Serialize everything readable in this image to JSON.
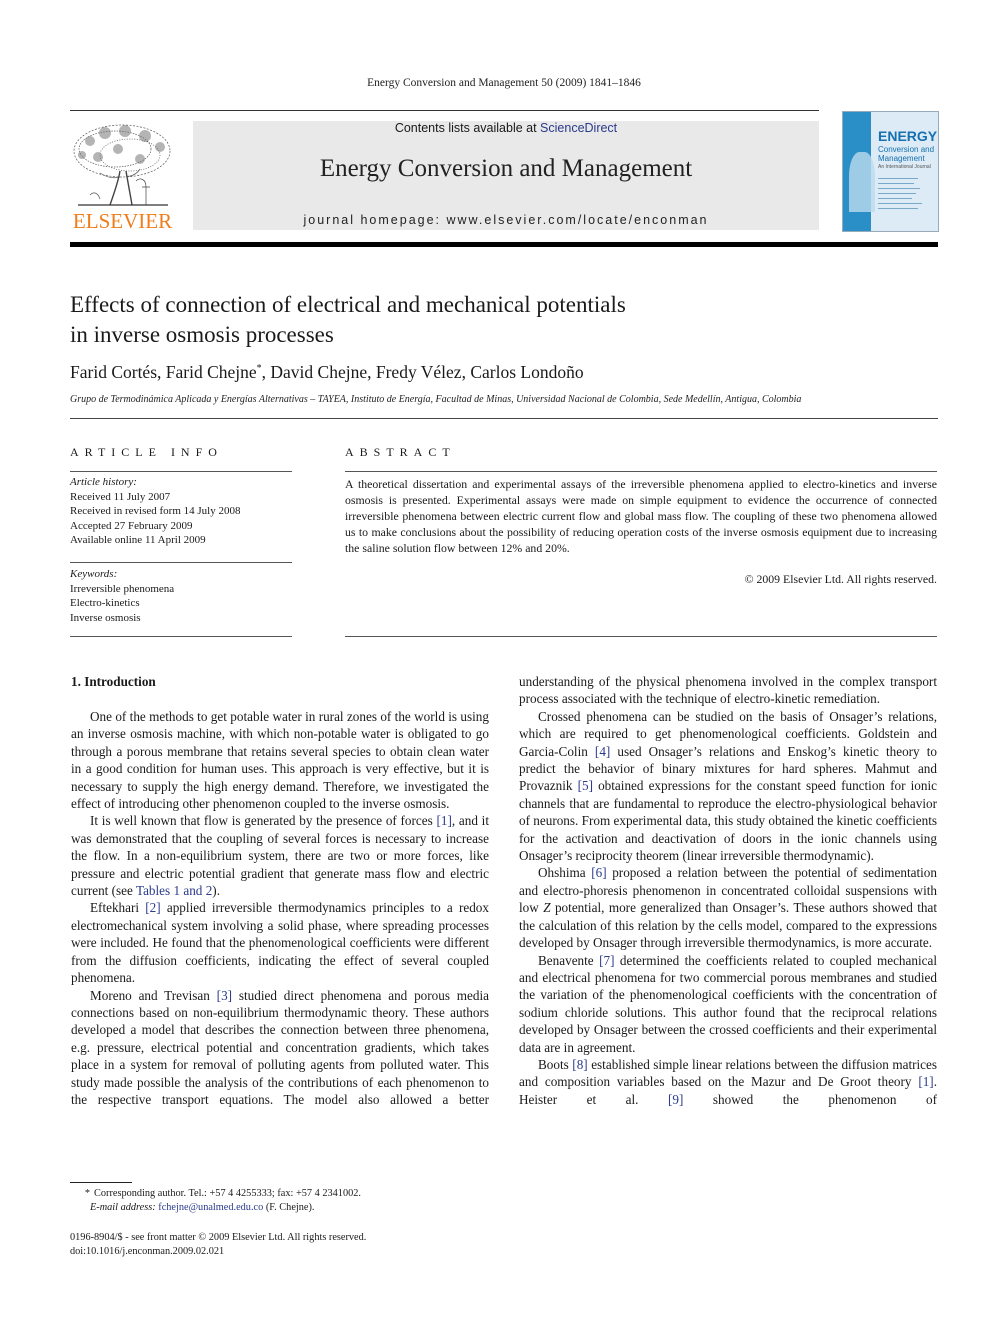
{
  "running_head": "Energy Conversion and Management 50 (2009) 1841–1846",
  "publisher": {
    "logo_icon": "elsevier-tree-icon",
    "name": "ELSEVIER",
    "brand_color": "#f07d1a"
  },
  "masthead": {
    "contents_prefix": "Contents lists available at ",
    "contents_link": "ScienceDirect",
    "journal_title": "Energy Conversion and Management",
    "homepage_line": "journal homepage: www.elsevier.com/locate/enconman",
    "background_color": "#e9e9e9",
    "link_color": "#2a3a8c"
  },
  "cover": {
    "icon": "journal-cover-image",
    "title": "ENERGY",
    "subtitle_1": "Conversion and",
    "subtitle_2": "Management",
    "tagline": "An International Journal",
    "accent_color": "#1670b0"
  },
  "article": {
    "title_line_1": "Effects of connection of electrical and mechanical potentials",
    "title_line_2": "in inverse osmosis processes",
    "authors": [
      {
        "name": "Farid Cortés",
        "sep": ", "
      },
      {
        "name": "Farid Chejne",
        "mark": "*",
        "sep": ", "
      },
      {
        "name": "David Chejne",
        "sep": ", "
      },
      {
        "name": "Fredy Vélez",
        "sep": ", "
      },
      {
        "name": "Carlos Londoño",
        "sep": ""
      }
    ],
    "affiliation": "Grupo de Termodinámica Aplicada y Energías Alternativas – TAYEA, Instituto de Energía, Facultad de Minas, Universidad Nacional de Colombia, Sede Medellín, Antigua, Colombia"
  },
  "article_info": {
    "heading": "ARTICLE INFO",
    "history_label": "Article history:",
    "history": [
      "Received 11 July 2007",
      "Received in revised form 14 July 2008",
      "Accepted 27 February 2009",
      "Available online 11 April 2009"
    ],
    "keywords_label": "Keywords:",
    "keywords": [
      "Irreversible phenomena",
      "Electro-kinetics",
      "Inverse osmosis"
    ]
  },
  "abstract": {
    "heading": "ABSTRACT",
    "text": "A theoretical dissertation and experimental assays of the irreversible phenomena applied to electro-kinetics and inverse osmosis is presented. Experimental assays were made on simple equipment to evidence the occurrence of connected irreversible phenomena between electric current flow and global mass flow. The coupling of these two phenomena allowed us to make conclusions about the possibility of reducing operation costs of the inverse osmosis equipment due to increasing the saline solution flow between 12% and 20%.",
    "copyright": "© 2009 Elsevier Ltd. All rights reserved."
  },
  "body": {
    "section_heading": "1. Introduction",
    "p1": "One of the methods to get potable water in rural zones of the world is using an inverse osmosis machine, with which non-potable water is obligated to go through a porous membrane that retains several species to obtain clean water in a good condition for human uses. This approach is very effective, but it is necessary to supply the high energy demand. Therefore, we investigated the effect of introducing other phenomenon coupled to the inverse osmosis.",
    "p2": {
      "a": "It is well known that flow is generated by the presence of forces ",
      "ref1": "[1]",
      "b": ", and it was demonstrated that the coupling of several forces is necessary to increase the flow. In a non-equilibrium system, there are two or more forces, like pressure and electric potential gradient that generate mass flow and electric current (see ",
      "ref_tables": "Tables 1 and 2",
      "c": ")."
    },
    "p3": {
      "a": "Eftekhari ",
      "ref": "[2]",
      "b": " applied irreversible thermodynamics principles to a redox electromechanical system involving a solid phase, where spreading processes were included. He found that the phenomenological coefficients were different from the diffusion coefficients, indicating the effect of several coupled phenomena."
    },
    "p4": {
      "a": "Moreno and Trevisan ",
      "ref": "[3]",
      "b": " studied direct phenomena and porous media connections based on non-equilibrium thermodynamic theory. These authors developed a model that describes the connection between three phenomena, e.g. pressure, electrical potential and concentration gradients, which takes place in a system for removal of polluting agents from polluted water. This study made possible the analysis of the contributions of each phenomenon to the respective transport equations. The model also allowed a better"
    },
    "p4_cont": "understanding of the physical phenomena involved in the complex transport process associated with the technique of electro-kinetic remediation.",
    "p5": {
      "a": "Crossed phenomena can be studied on the basis of Onsager’s relations, which are required to get phenomenological coefficients. Goldstein and Garcia-Colin ",
      "ref4": "[4]",
      "b": " used Onsager’s relations and Enskog’s kinetic theory to predict the behavior of binary mixtures for hard spheres. Mahmut and Provaznik ",
      "ref5": "[5]",
      "c": " obtained expressions for the constant speed function for ionic channels that are fundamental to reproduce the electro-physiological behavior of neurons. From experimental data, this study obtained the kinetic coefficients for the activation and deactivation of doors in the ionic channels using Onsager’s reciprocity theorem (linear irreversible thermodynamic)."
    },
    "p6": {
      "a": "Ohshima ",
      "ref": "[6]",
      "b": " proposed a relation between the potential of sedimentation and electro-phoresis phenomenon in concentrated colloidal suspensions with low ",
      "z": "Z",
      "c": " potential, more generalized than Onsager’s. These authors showed that the calculation of this relation by the cells model, compared to the expressions developed by Onsager through irreversible thermodynamics, is more accurate."
    },
    "p7": {
      "a": "Benavente ",
      "ref": "[7]",
      "b": " determined the coefficients related to coupled mechanical and electrical phenomena for two commercial porous membranes and studied the variation of the phenomenological coefficients with the concentration of sodium chloride solutions. This author found that the reciprocal relations developed by Onsager between the crossed coefficients and their experimental data are in agreement."
    },
    "p8": {
      "a": "Boots ",
      "ref8": "[8]",
      "b": " established simple linear relations between the diffusion matrices and composition variables based on the Mazur and De Groot theory ",
      "ref1": "[1]",
      "c": ". Heister et al. ",
      "ref9": "[9]",
      "d": " showed the phenomenon of"
    }
  },
  "footnote": {
    "mark": "*",
    "contact": "Corresponding author. Tel.: +57 4 4255333; fax: +57 4 2341002.",
    "email_label": "E-mail address: ",
    "email": "fchejne@unalmed.edu.co",
    "email_suffix": " (F. Chejne)."
  },
  "front_matter": {
    "issn_line": "0196-8904/$ - see front matter © 2009 Elsevier Ltd. All rights reserved.",
    "doi": "doi:10.1016/j.enconman.2009.02.021"
  }
}
